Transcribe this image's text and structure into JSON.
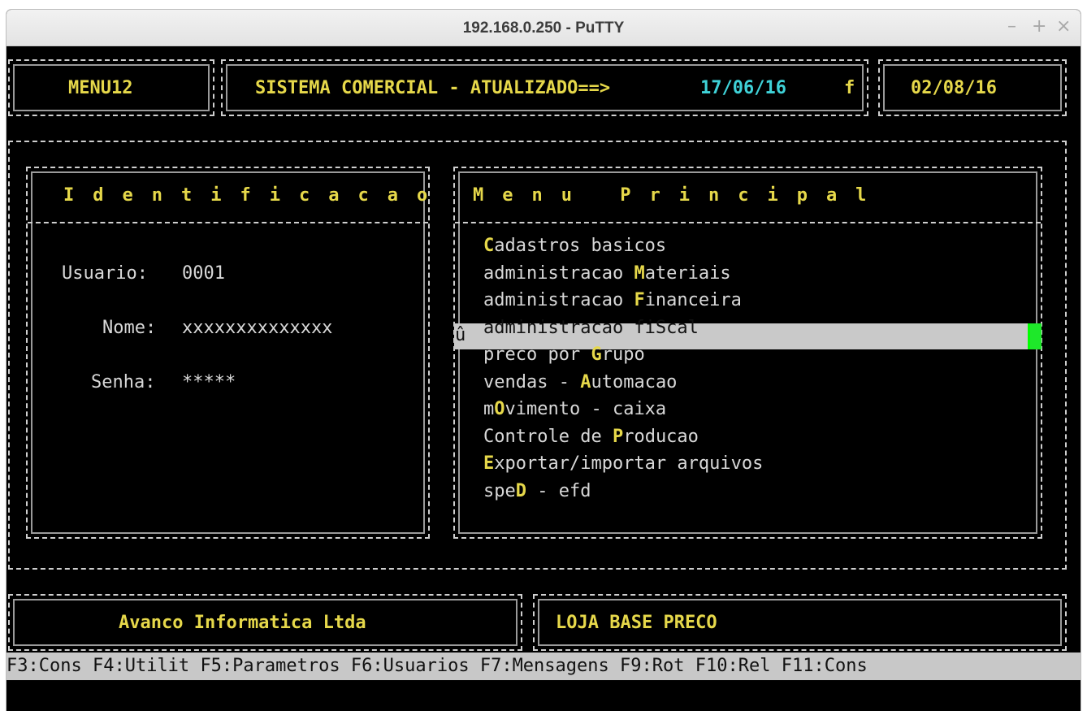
{
  "window": {
    "title": "192.168.0.250 - PuTTY",
    "minimize_glyph": "–",
    "maximize_glyph": "+",
    "close_glyph": "×"
  },
  "header": {
    "menu_code": "MENU12",
    "system_label": "SISTEMA COMERCIAL - ATUALIZADO==>",
    "updated_date": "17/06/16",
    "flag": "f",
    "current_date": "02/08/16"
  },
  "identification": {
    "title": "Identificacao",
    "usuario_label": "Usuario:",
    "usuario_value": "0001",
    "nome_label": "Nome:",
    "nome_value": "xxxxxxxxxxxxxx",
    "senha_label": "Senha:",
    "senha_value": "*****"
  },
  "menu": {
    "title": "Menu Principal",
    "marker": "û",
    "items": [
      {
        "pre": "",
        "key": "C",
        "post": "adastros basicos"
      },
      {
        "pre": "administracao ",
        "key": "M",
        "post": "ateriais"
      },
      {
        "pre": "administracao ",
        "key": "F",
        "post": "inanceira"
      },
      {
        "pre": "administracao fiScal",
        "key": "",
        "post": ""
      },
      {
        "pre": "preco por ",
        "key": "G",
        "post": "rupo"
      },
      {
        "pre": "vendas - ",
        "key": "A",
        "post": "utomacao"
      },
      {
        "pre": "m",
        "key": "O",
        "post": "vimento - caixa"
      },
      {
        "pre": "Controle de ",
        "key": "P",
        "post": "roducao"
      },
      {
        "pre": "",
        "key": "E",
        "post": "xportar/importar arquivos"
      },
      {
        "pre": "spe",
        "key": "D",
        "post": " - efd"
      }
    ],
    "selected_index": 3
  },
  "footer": {
    "company": "Avanco Informatica Ltda",
    "store": "LOJA BASE PRECO"
  },
  "function_keys": [
    "F3:Cons",
    "F4:Utilit",
    "F5:Parametros",
    "F6:Usuarios",
    "F7:Mensagens",
    "F9:Rot",
    "F10:Rel",
    "F11:Cons"
  ],
  "colors": {
    "text": "#d8d8d8",
    "highlight_yellow": "#e6d84a",
    "highlight_cyan": "#3fd2d8",
    "selection": "#c9c9c9",
    "cursor": "#1ee82a",
    "background": "#000000"
  }
}
